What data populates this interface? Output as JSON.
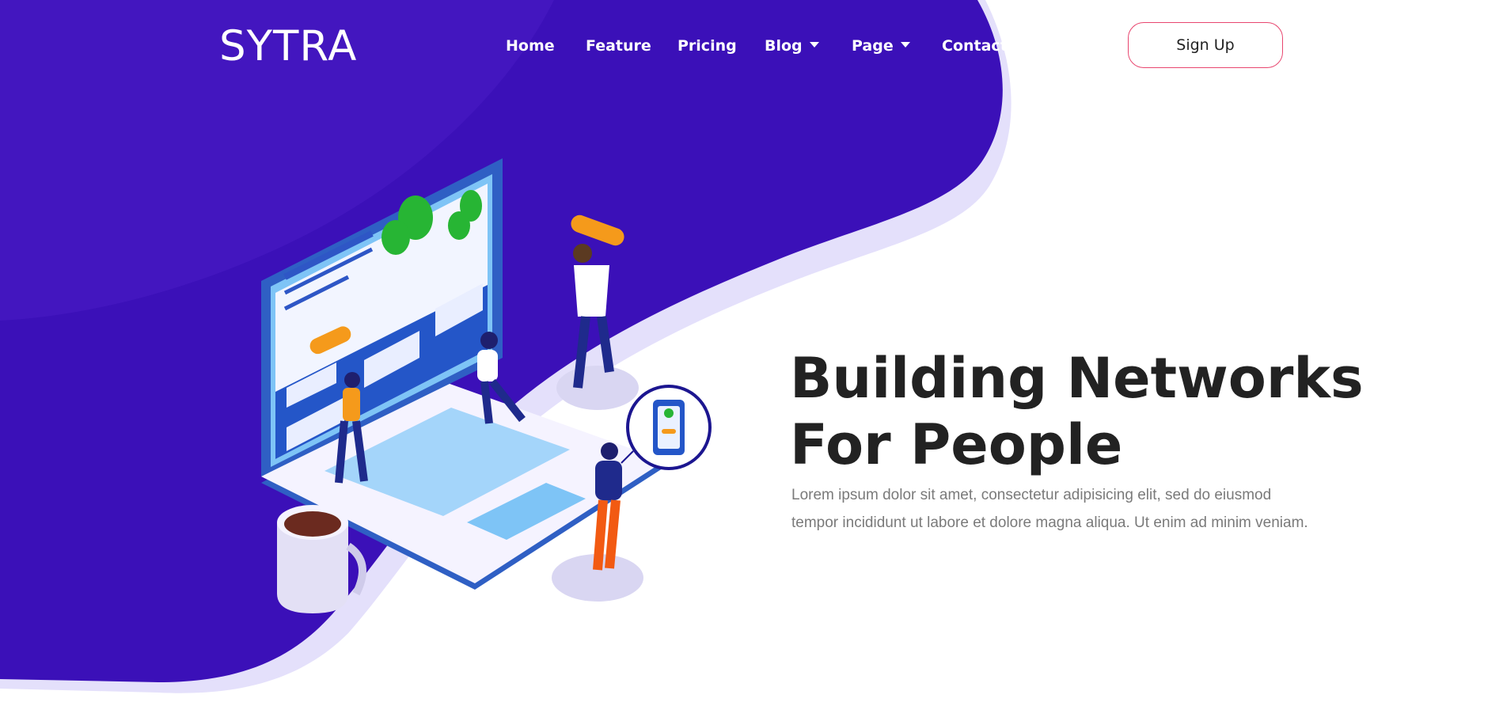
{
  "brand": {
    "logo_text": "SYTRA"
  },
  "nav": {
    "items": [
      {
        "label": "Home",
        "dropdown": false
      },
      {
        "label": "Feature",
        "dropdown": false
      },
      {
        "label": "Pricing",
        "dropdown": false
      },
      {
        "label": "Blog",
        "dropdown": true
      },
      {
        "label": "Page",
        "dropdown": true
      },
      {
        "label": "Contact",
        "dropdown": false
      }
    ],
    "signup_label": "Sign Up"
  },
  "hero": {
    "title_line1": "Building Networks",
    "title_line2": "For People",
    "description": "Lorem ipsum dolor sit amet, consectetur adipisicing elit, sed do eiusmod tempor incididunt ut labore et dolore magna aliqua. Ut enim ad minim veniam."
  },
  "colors": {
    "primary_blob": "#3b10b8",
    "blob_shadow": "#e4e0fb",
    "signup_border": "#e8466f",
    "title": "#222222",
    "text_muted": "#7a7a7a"
  },
  "illustration": {
    "subject": "isometric laptop with people building a network",
    "icons": [
      "laptop-icon",
      "coffee-mug-icon",
      "phone-bubble-icon",
      "tree-icon"
    ]
  }
}
